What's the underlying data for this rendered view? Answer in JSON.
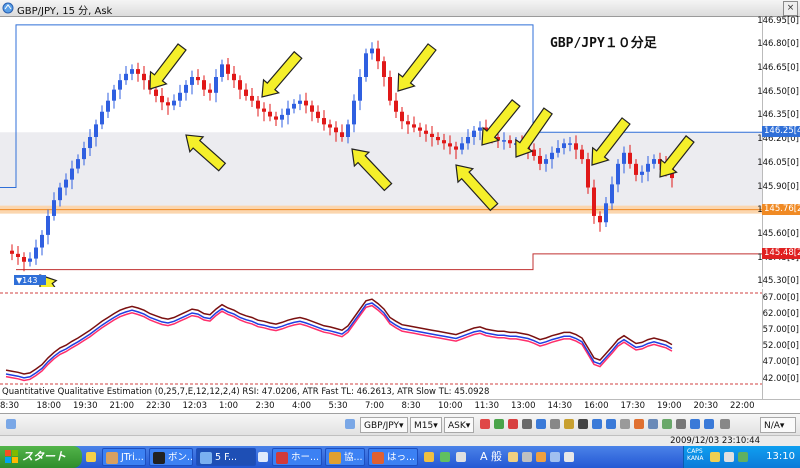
{
  "window": {
    "title": "GBP/JPY, 15 分, Ask",
    "close_glyph": "×"
  },
  "chart_data": {
    "type": "candlestick",
    "title": "GBP/JPY１０分足",
    "price_axis": {
      "labels": [
        "146.95",
        "146.80",
        "146.65",
        "146.50",
        "146.35",
        "146.20",
        "146.05",
        "145.90",
        "145.75",
        "145.60",
        "145.45",
        "145.30"
      ],
      "suffix": "[0]",
      "range": [
        145.27,
        146.98
      ]
    },
    "horizontal_levels": [
      {
        "price": 146.25,
        "tag": "146.25[4",
        "color": "#2f6fd8"
      },
      {
        "price": 145.76,
        "tag": "145.76[2",
        "color": "#f08a24"
      },
      {
        "price": 145.48,
        "tag": "145.48[2",
        "color": "#e02020"
      }
    ],
    "left_marker": "▼143",
    "candles_approx": [
      145.5,
      145.48,
      145.46,
      145.43,
      145.45,
      145.52,
      145.6,
      145.72,
      145.82,
      145.9,
      145.95,
      146.02,
      146.08,
      146.15,
      146.22,
      146.3,
      146.38,
      146.45,
      146.52,
      146.58,
      146.62,
      146.65,
      146.62,
      146.58,
      146.52,
      146.48,
      146.44,
      146.42,
      146.45,
      146.5,
      146.55,
      146.6,
      146.58,
      146.52,
      146.5,
      146.6,
      146.68,
      146.62,
      146.58,
      146.52,
      146.48,
      146.45,
      146.4,
      146.38,
      146.35,
      146.33,
      146.36,
      146.4,
      146.43,
      146.45,
      146.42,
      146.38,
      146.34,
      146.3,
      146.28,
      146.25,
      146.22,
      146.3,
      146.45,
      146.6,
      146.75,
      146.78,
      146.7,
      146.6,
      146.45,
      146.38,
      146.32,
      146.3,
      146.28,
      146.26,
      146.24,
      146.22,
      146.2,
      146.18,
      146.16,
      146.14,
      146.18,
      146.22,
      146.26,
      146.28,
      146.24,
      146.22,
      146.2,
      146.2,
      146.18,
      146.18,
      146.16,
      146.14,
      146.1,
      146.05,
      146.08,
      146.12,
      146.15,
      146.18,
      146.18,
      146.14,
      146.08,
      145.9,
      145.72,
      145.68,
      145.8,
      145.92,
      146.05,
      146.12,
      146.05,
      145.98,
      146.0,
      146.05,
      146.08,
      146.05,
      146.02,
      145.96
    ],
    "indicator": {
      "name": "Quantitative Qualitative Estimation (0,25,7,E,12,12,2,4)",
      "legend_text": "Quantitative Qualitative Estimation (0,25,7,E,12,12,2,4) RSI: 47.0206, ATR Fast TL: 46.2613, ATR Slow TL: 45.0928",
      "levels": [
        "67.00[0]",
        "62.00[0]",
        "57.00[0]",
        "52.00[0]",
        "47.00[0]",
        "42.00[0]"
      ],
      "range": [
        40,
        70
      ]
    },
    "time_axis": [
      "8:30",
      "18:00",
      "19:30",
      "21:00",
      "22:30",
      "12:03",
      "1:00",
      "2:30",
      "4:00",
      "5:30",
      "7:00",
      "8:30",
      "10:00",
      "11:30",
      "13:00",
      "14:30",
      "16:00",
      "17:30",
      "19:00",
      "20:30",
      "22:00"
    ]
  },
  "toolbar": {
    "symbol": "GBP/JPY",
    "timeframe": "M15",
    "side": "ASK",
    "zoom": "N/A",
    "arrow": "▾"
  },
  "status": {
    "timestamp": "2009/12/03 23:10:44"
  },
  "taskbar": {
    "start_label": "スタート",
    "tasks": [
      "JTri...",
      "ボン...",
      "5 F...",
      "ホー...",
      "協...",
      "はっ..."
    ],
    "ime": "A 般",
    "caps": [
      "CAPS",
      "KANA"
    ],
    "clock": "13:10"
  }
}
